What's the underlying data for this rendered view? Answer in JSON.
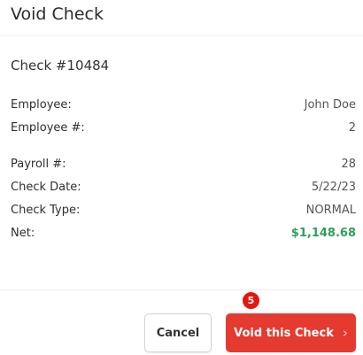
{
  "dialog": {
    "title": "Void Check",
    "check_number": "Check #10484",
    "details": [
      [
        {
          "label": "Employee:",
          "value": "John Doe"
        },
        {
          "label": "Employee #:",
          "value": "2"
        }
      ],
      [
        {
          "label": "Payroll #:",
          "value": "28"
        },
        {
          "label": "Check Date:",
          "value": "5/22/23"
        },
        {
          "label": "Check Type:",
          "value": "NORMAL"
        },
        {
          "label": "Net:",
          "value": "$1,148.68"
        }
      ]
    ]
  },
  "footer": {
    "cancel_label": "Cancel",
    "void_label": "Void this Check",
    "chevron_icon": "chevron-right-icon",
    "step_badge": "5"
  },
  "colors": {
    "primary": "#e53a2f",
    "net_value": "#2ea05a",
    "badge": "#e2170f"
  }
}
